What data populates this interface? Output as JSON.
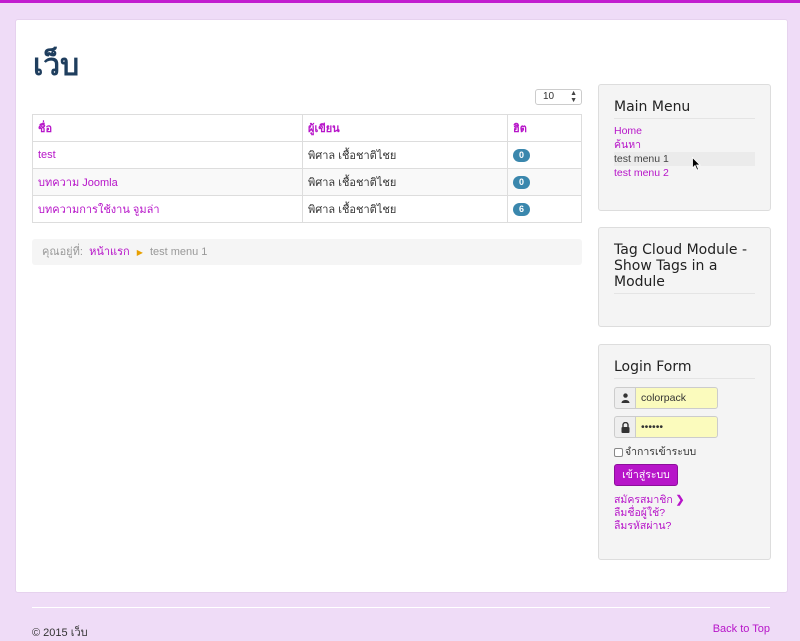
{
  "site": {
    "title": "เว็บ"
  },
  "list_limit": {
    "value": "10"
  },
  "table": {
    "headers": {
      "title": "ชื่อ",
      "author": "ผู้เขียน",
      "hits": "ฮิต"
    },
    "rows": [
      {
        "title": "test",
        "author": "พิศาล เชื้อชาติไชย",
        "hits": "0"
      },
      {
        "title": "บทความ Joomla",
        "author": "พิศาล เชื้อชาติไชย",
        "hits": "0"
      },
      {
        "title": "บทความการใช้งาน จูมล่า",
        "author": "พิศาล เชื้อชาติไชย",
        "hits": "6"
      }
    ]
  },
  "breadcrumb": {
    "label": "คุณอยู่ที่:",
    "home": "หน้าแรก",
    "current": "test menu 1"
  },
  "main_menu": {
    "title": "Main Menu",
    "items": [
      {
        "label": "Home"
      },
      {
        "label": "ค้นหา"
      },
      {
        "label": "test menu 1"
      },
      {
        "label": "test menu 2"
      }
    ]
  },
  "tag_cloud": {
    "title": "Tag Cloud Module - Show Tags in a Module"
  },
  "login": {
    "title": "Login Form",
    "username": "colorpack",
    "password": "••••••",
    "remember_label": "จำการเข้าระบบ",
    "submit_label": "เข้าสู่ระบบ",
    "register_label": "สมัครสมาชิก",
    "forgot_username": "ลืมชื่อผู้ใช้?",
    "forgot_password": "ลืมรหัสผ่าน?"
  },
  "footer": {
    "copyright": "© 2015 เว็บ",
    "back_to_top": "Back to Top"
  },
  "colors": {
    "accent": "#b715c9",
    "title": "#1f3e5e",
    "badge": "#3a87ad",
    "input_bg": "#fbfbbd"
  }
}
